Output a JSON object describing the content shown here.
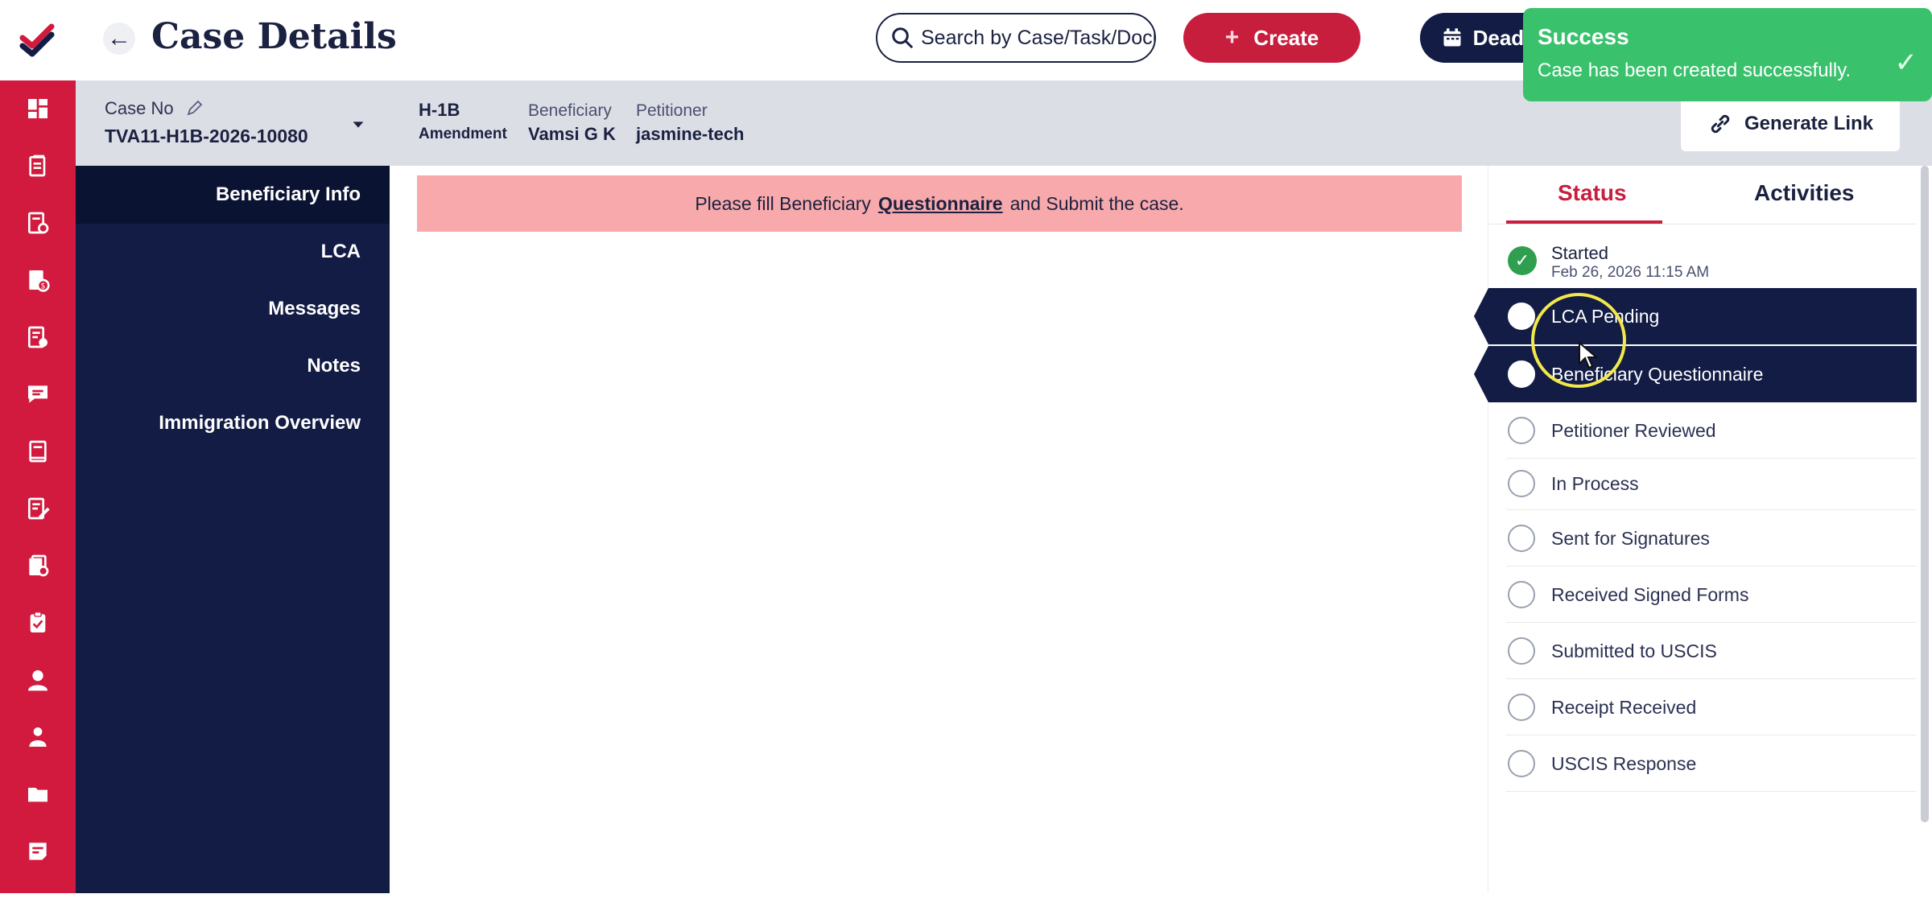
{
  "header": {
    "title": "Case Details",
    "search_placeholder": "Search by Case/Task/Document",
    "create_label": "Create",
    "deadlines_label": "Deadlines"
  },
  "toast": {
    "title": "Success",
    "message": "Case has been created successfully."
  },
  "case_bar": {
    "case_no_label": "Case No",
    "case_no": "TVA11-H1B-2026-10080",
    "visa_type": "H-1B",
    "case_sub_type": "Amendment",
    "beneficiary_label": "Beneficiary",
    "beneficiary": "Vamsi G K",
    "petitioner_label": "Petitioner",
    "petitioner": "jasmine-tech",
    "generate_link_label": "Generate Link"
  },
  "section_nav": {
    "items": [
      {
        "label": "Beneficiary Info"
      },
      {
        "label": "LCA"
      },
      {
        "label": "Messages"
      },
      {
        "label": "Notes"
      },
      {
        "label": "Immigration Overview"
      }
    ]
  },
  "alert": {
    "before": "Please fill Beneficiary",
    "link": "Questionnaire",
    "after": "and Submit the case."
  },
  "status_panel": {
    "tabs": [
      "Status",
      "Activities"
    ],
    "steps": [
      {
        "label": "Started",
        "date": "Feb 26, 2026 11:15 AM",
        "state": "done"
      },
      {
        "label": "LCA Pending",
        "state": "active"
      },
      {
        "label": "Beneficiary Questionnaire",
        "state": "active"
      },
      {
        "label": "Petitioner Reviewed",
        "state": "pending"
      },
      {
        "label": "In Process",
        "state": "pending"
      },
      {
        "label": "Sent for Signatures",
        "state": "pending"
      },
      {
        "label": "Received Signed Forms",
        "state": "pending"
      },
      {
        "label": "Submitted to USCIS",
        "state": "pending"
      },
      {
        "label": "Receipt Received",
        "state": "pending"
      },
      {
        "label": "USCIS Response",
        "state": "pending"
      }
    ]
  },
  "colors": {
    "brand_red": "#d11a3e",
    "navy": "#121c44",
    "success_green": "#39c16c",
    "alert_pink": "#f7a9ab"
  },
  "rail_icons": [
    "dashboard-icon",
    "cases-icon",
    "document-check-icon",
    "billing-icon",
    "forms-icon",
    "chat-icon",
    "ledger-icon",
    "notes-edit-icon",
    "approvals-icon",
    "clipboard-icon",
    "user-icon",
    "contacts-icon",
    "folder-icon",
    "reports-icon"
  ]
}
